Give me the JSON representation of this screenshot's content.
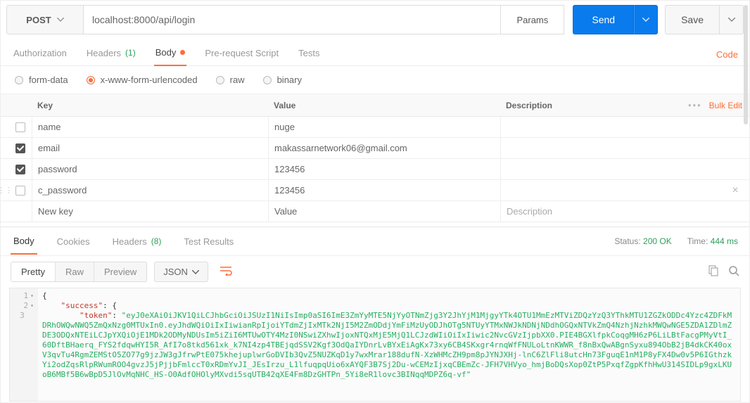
{
  "request": {
    "method": "POST",
    "url": "localhost:8000/api/login",
    "params_label": "Params",
    "send_label": "Send",
    "save_label": "Save"
  },
  "code_link": "Code",
  "req_tabs": {
    "authorization": "Authorization",
    "headers": "Headers",
    "headers_count": "(1)",
    "body": "Body",
    "pre_request": "Pre-request Script",
    "tests": "Tests"
  },
  "body_types": {
    "form_data": "form-data",
    "urlencoded": "x-www-form-urlencoded",
    "raw": "raw",
    "binary": "binary"
  },
  "kv": {
    "head_key": "Key",
    "head_value": "Value",
    "head_desc": "Description",
    "bulk_edit": "Bulk Edit",
    "rows": [
      {
        "checked": false,
        "key": "name",
        "value": "nuge",
        "desc": ""
      },
      {
        "checked": true,
        "key": "email",
        "value": "makassarnetwork06@gmail.com",
        "desc": ""
      },
      {
        "checked": true,
        "key": "password",
        "value": "123456",
        "desc": ""
      },
      {
        "checked": false,
        "key": "c_password",
        "value": "123456",
        "desc": ""
      }
    ],
    "new_key_ph": "New key",
    "new_val_ph": "Value",
    "new_desc_ph": "Description"
  },
  "resp_tabs": {
    "body": "Body",
    "cookies": "Cookies",
    "headers": "Headers",
    "headers_count": "(8)",
    "test_results": "Test Results"
  },
  "resp_meta": {
    "status_label": "Status:",
    "status_value": "200 OK",
    "time_label": "Time:",
    "time_value": "444 ms"
  },
  "resp_view": {
    "pretty": "Pretty",
    "raw": "Raw",
    "preview": "Preview",
    "type": "JSON"
  },
  "json_response": {
    "k_success": "\"success\"",
    "k_token": "\"token\"",
    "v_token": "\"eyJ0eXAiOiJKV1QiLCJhbGciOiJSUzI1NiIsImp0aSI6ImE3ZmYyMTE5NjYyOTNmZjg3Y2JhYjM1MjgyYTk4OTU1MmEzMTViZDQzYzQ3YThkMTU1ZGZkODDc4Yzc4ZDFkMDRhOWQwNWQ5ZmQxNzg0MTUxIn0.eyJhdWQiOiIxIiwianRpIjoiYTdmZjIxMTk2NjI5M2ZmODdjYmFiMzUyODJhOTg5NTUyYTMxNWJkNDNjNDdhOGQxNTVkZmQ4NzhjNzhkMWQwNGE5ZDA1ZDlmZDE3ODQxNTEiLCJpYXQiOjE1MDk2ODMyNDUsIm5iZiI6MTUwOTY4MzI0NSwiZXhwIjoxNTQxMjE5MjQ1LCJzdWIiOiIxIiwic2NvcGVzIjpbXX0.PIE4BGXlfpkCoqgMH6zP6LiLBtFacgPMyVtI_60DftBHaerq_FYS2fdqwHYI5R_AfI7o8tkd561xk_k7NI4zp4TBEjqdSSV2Kgf3OdQaIYDnrLvBYxEiAgKx73xy6CB4SKxgr4rnqWfFNULoLtnKWWR_f8nBxQwABgnSyxu894ObB2jB4dkCK40oxV3qvTu4RgmZEMStO5ZO77g9jzJW3gJfrwPtE075khejuplwrGoDVIb3QvZ5NUZKqD1y7wxMrar188dufN-XzWHMcZH9pm8pJYNJXHj-lnC6ZlFli8utcHn73FguqE1nM1P8yFX4Dw0v5P6IGthzkYi2odZqsRlpRWumROO4gvzJ5jPjjbFmlccT0xRDmYvJI_JEsIrzu_L1lfuqpqUio6xAYQF3B7Sj2Du-wCEMzIjxqCBEmZc-JFH7VHVyo_hmjBoDQsXop0ZtP5PxqfZgpKfhHwU314SIDLp9gxLKUoB6MBf5B6wBpD5JlOvMqNHC_HS-O0AdfOHOlyMXvdi5sqUTB42qXE4Fm8DzGHTPn_5Yi8eR1lovc3BINqqMDPZ6q-vf\""
  }
}
